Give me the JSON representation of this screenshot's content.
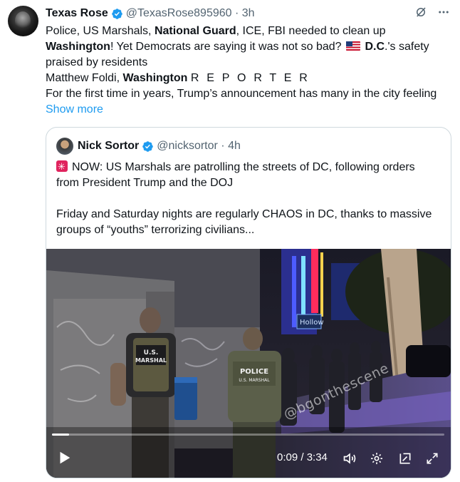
{
  "post": {
    "author_name": "Texas Rose",
    "author_handle": "@TexasRose895960",
    "time": "3h",
    "line1": [
      "Police, US Marshals, ",
      "National Guard",
      ", ICE, FBI needed to clean up"
    ],
    "line2": [
      "Washington",
      "!  Yet Democrats are saying it was not so bad? ",
      "D.C",
      ".'s safety"
    ],
    "line3": "praised by residents",
    "line4": [
      "Matthew Foldi, ",
      "Washington",
      "R E P O R T E R"
    ],
    "line5": "For the first time in years, Trump’s announcement has many in the city feeling",
    "show_more": "Show more"
  },
  "quote": {
    "author_name": "Nick Sortor",
    "author_handle": "@nicksortor",
    "time": "4h",
    "line1": "NOW: US Marshals are patrolling the streets of DC, following orders",
    "line2": "from President Trump and the DOJ",
    "line3": "Friday and Saturday nights are regularly CHAOS in DC, thanks to massive",
    "line4": "groups of “youths” terrorizing civilians..."
  },
  "video": {
    "watermark": "@bgonthescene",
    "vest_left": [
      "U.S.",
      "MARSHAL"
    ],
    "vest_right": [
      "POLICE",
      "U.S. MARSHAL"
    ],
    "sign": "Hollow",
    "time_display": "0:09 / 3:34",
    "progress": 0.043
  },
  "colors": {
    "accent": "#1d9bf0",
    "verified": "#1d9bf0",
    "handle_gray": "#536471"
  },
  "icons": [
    "verified-badge-icon",
    "grok-icon",
    "more-icon",
    "flag-us-icon",
    "alarm-icon",
    "play-icon",
    "volume-icon",
    "settings-icon",
    "minimize-icon",
    "fullscreen-icon"
  ]
}
